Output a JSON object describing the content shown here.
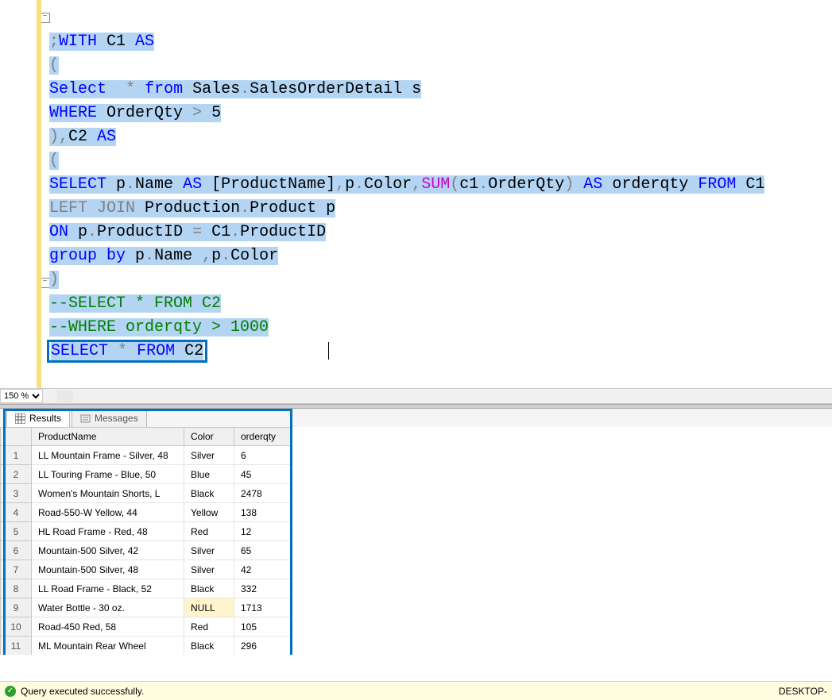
{
  "editor": {
    "zoom": "150 %",
    "code_tokens": "see markup binds",
    "l1": {
      "t1": ";",
      "t2": "WITH",
      "t3": " C1 ",
      "t4": "AS"
    },
    "l2": {
      "t1": "("
    },
    "l3": {
      "t1": "Select",
      "t2": "  ",
      "t3": "*",
      "t4": " ",
      "t5": "from",
      "t6": " Sales",
      "t7": ".",
      "t8": "SalesOrderDetail s"
    },
    "l4": {
      "t1": "WHERE",
      "t2": " OrderQty ",
      "t3": ">",
      "t4": " 5"
    },
    "l5": {
      "t1": ")",
      "t2": ",",
      "t3": "C2 ",
      "t4": "AS"
    },
    "l6": {
      "t1": "("
    },
    "l7": {
      "t1": "SELECT",
      "t2": " p",
      "t3": ".",
      "t4": "Name ",
      "t5": "AS",
      "t6": " [ProductName]",
      "t7": ",",
      "t8": "p",
      "t9": ".",
      "t10": "Color",
      "t11": ",",
      "t12": "SUM",
      "t13": "(",
      "t14": "c1",
      "t15": ".",
      "t16": "OrderQty",
      "t17": ")",
      "t18": " ",
      "t19": "AS",
      "t20": " orderqty ",
      "t21": "FROM",
      "t22": " C1"
    },
    "l8": {
      "t1": "LEFT",
      "t2": " ",
      "t3": "JOIN",
      "t4": " Production",
      "t5": ".",
      "t6": "Product p"
    },
    "l9": {
      "t1": "ON",
      "t2": " p",
      "t3": ".",
      "t4": "ProductID ",
      "t5": "=",
      "t6": " C1",
      "t7": ".",
      "t8": "ProductID"
    },
    "l10": {
      "t1": "group",
      "t2": " ",
      "t3": "by",
      "t4": " p",
      "t5": ".",
      "t6": "Name ",
      "t7": ",",
      "t8": "p",
      "t9": ".",
      "t10": "Color"
    },
    "l11": {
      "t1": ")"
    },
    "l12": {
      "t1": "--SELECT * FROM C2"
    },
    "l13": {
      "t1": "--WHERE orderqty > 1000"
    },
    "l14": {
      "t1": "SELECT",
      "t2": " ",
      "t3": "*",
      "t4": " ",
      "t5": "FROM",
      "t6": " C2"
    }
  },
  "tabs": {
    "results": "Results",
    "messages": "Messages"
  },
  "grid": {
    "headers": [
      "",
      "ProductName",
      "Color",
      "orderqty"
    ],
    "rows": [
      [
        "1",
        "LL Mountain Frame - Silver, 48",
        "Silver",
        "6"
      ],
      [
        "2",
        "LL Touring Frame - Blue, 50",
        "Blue",
        "45"
      ],
      [
        "3",
        "Women's Mountain Shorts, L",
        "Black",
        "2478"
      ],
      [
        "4",
        "Road-550-W Yellow, 44",
        "Yellow",
        "138"
      ],
      [
        "5",
        "HL Road Frame - Red, 48",
        "Red",
        "12"
      ],
      [
        "6",
        "Mountain-500 Silver, 42",
        "Silver",
        "65"
      ],
      [
        "7",
        "Mountain-500 Silver, 48",
        "Silver",
        "42"
      ],
      [
        "8",
        "LL Road Frame - Black, 52",
        "Black",
        "332"
      ],
      [
        "9",
        "Water Bottle - 30 oz.",
        "NULL",
        "1713"
      ],
      [
        "10",
        "Road-450 Red, 58",
        "Red",
        "105"
      ],
      [
        "11",
        "ML Mountain Rear Wheel",
        "Black",
        "296"
      ]
    ]
  },
  "status": {
    "msg": "Query executed successfully.",
    "server": "DESKTOP-"
  },
  "chart_data": {
    "type": "table",
    "title": "Query results: orderqty by ProductName and Color",
    "columns": [
      "ProductName",
      "Color",
      "orderqty"
    ],
    "rows": [
      [
        "LL Mountain Frame - Silver, 48",
        "Silver",
        6
      ],
      [
        "LL Touring Frame - Blue, 50",
        "Blue",
        45
      ],
      [
        "Women's Mountain Shorts, L",
        "Black",
        2478
      ],
      [
        "Road-550-W Yellow, 44",
        "Yellow",
        138
      ],
      [
        "HL Road Frame - Red, 48",
        "Red",
        12
      ],
      [
        "Mountain-500 Silver, 42",
        "Silver",
        65
      ],
      [
        "Mountain-500 Silver, 48",
        "Silver",
        42
      ],
      [
        "LL Road Frame - Black, 52",
        "Black",
        332
      ],
      [
        "Water Bottle - 30 oz.",
        null,
        1713
      ],
      [
        "Road-450 Red, 58",
        "Red",
        105
      ],
      [
        "ML Mountain Rear Wheel",
        "Black",
        296
      ]
    ]
  }
}
